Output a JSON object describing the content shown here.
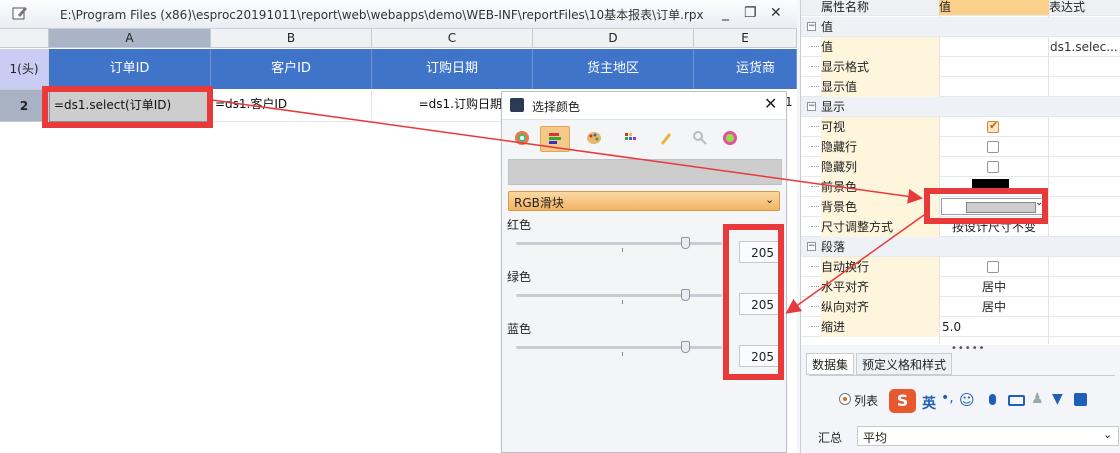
{
  "window": {
    "title": "E:\\Program Files (x86)\\esproc20191011\\report\\web\\webapps\\demo\\WEB-INF\\reportFiles\\10基本报表\\订单.rpx",
    "controls": [
      "_",
      "❐",
      "✕"
    ]
  },
  "grid": {
    "columns": [
      "A",
      "B",
      "C",
      "D",
      "E"
    ],
    "row1_header": "1(头)",
    "row2_header": "2",
    "row1": [
      "订单ID",
      "客户ID",
      "订购日期",
      "货主地区",
      "运货商"
    ],
    "row2": [
      "=ds1.select(订单ID)",
      "=ds1.客户ID",
      "=ds1.订购日期",
      "",
      ""
    ],
    "edge_digit": "1"
  },
  "color_dialog": {
    "title": "选择颜色",
    "mode": "RGB滑块",
    "channels": [
      {
        "label": "红色",
        "value": "205"
      },
      {
        "label": "绿色",
        "value": "205"
      },
      {
        "label": "蓝色",
        "value": "205"
      }
    ],
    "preview_color": "#cdcdcd"
  },
  "properties": {
    "header": {
      "name": "属性名称",
      "value": "值",
      "expr": "表达式"
    },
    "rows": [
      {
        "type": "group",
        "name": "值"
      },
      {
        "type": "item",
        "name": "值",
        "value": "",
        "expr": "ds1.selec..."
      },
      {
        "type": "item",
        "name": "显示格式",
        "value": "",
        "expr": ""
      },
      {
        "type": "item",
        "name": "显示值",
        "value": "",
        "expr": ""
      },
      {
        "type": "group",
        "name": "显示"
      },
      {
        "type": "item",
        "name": "可视",
        "value": "checked",
        "expr": ""
      },
      {
        "type": "item",
        "name": "隐藏行",
        "value": "unchecked",
        "expr": ""
      },
      {
        "type": "item",
        "name": "隐藏列",
        "value": "unchecked",
        "expr": ""
      },
      {
        "type": "item",
        "name": "前景色",
        "value": "black",
        "expr": ""
      },
      {
        "type": "item",
        "name": "背景色",
        "value": "color-combo",
        "expr": ""
      },
      {
        "type": "item",
        "name": "尺寸调整方式",
        "value": "按设计尺寸不变",
        "expr": ""
      },
      {
        "type": "group",
        "name": "段落"
      },
      {
        "type": "item",
        "name": "自动换行",
        "value": "unchecked",
        "expr": ""
      },
      {
        "type": "item",
        "name": "水平对齐",
        "value": "居中",
        "expr": ""
      },
      {
        "type": "item",
        "name": "纵向对齐",
        "value": "居中",
        "expr": ""
      },
      {
        "type": "item",
        "name": "缩进",
        "value": "5.0",
        "expr": ""
      }
    ],
    "foreground_color": "#000000",
    "background_color": "#cdcdcd"
  },
  "bottom_panel": {
    "tabs": [
      "数据集",
      "预定义格和样式"
    ],
    "radio_label": "列表",
    "ime_label": "英",
    "summary_label": "汇总",
    "summary_value": "平均"
  },
  "annotation_color": "#e8393b",
  "header_blue": "#3f74c8"
}
